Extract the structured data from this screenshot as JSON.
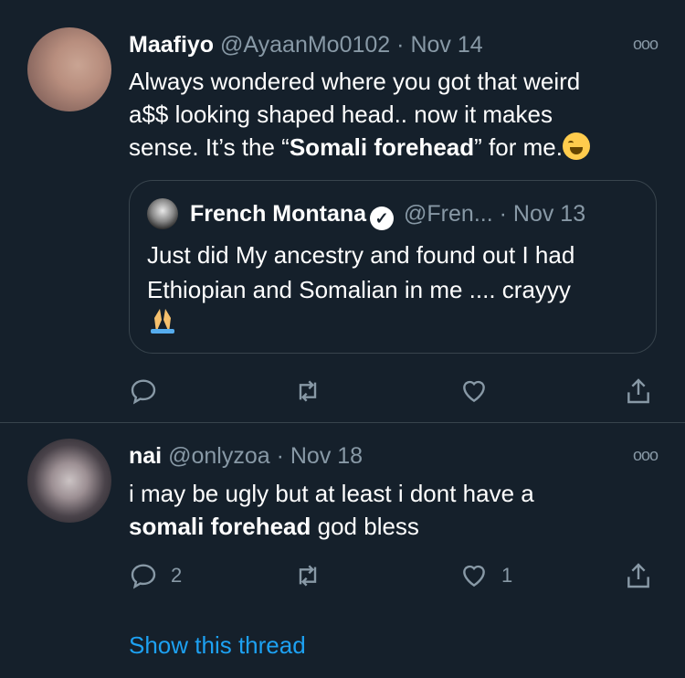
{
  "tweet1": {
    "name": "Maafiyo",
    "handle": "@AyaanMo0102",
    "sep": "·",
    "date": "Nov 14",
    "more": "ooo",
    "text_line1": "Always wondered where you got that weird",
    "text_line2": "a$$ looking shaped head.. now it makes",
    "text_line3_pre": "sense. It’s the “",
    "text_line3_bold": "Somali forehead",
    "text_line3_post": "” for me.",
    "emoji": "face-with-tears-of-joy-icon"
  },
  "quote": {
    "name": "French Montana",
    "verified": "✓",
    "handle": "@Fren...",
    "sep": "·",
    "date": "Nov 13",
    "text_line1": "Just did My ancestry and found out I had",
    "text_line2": "Ethiopian and Somalian in me .... crayyy",
    "emoji": "folded-hands-icon"
  },
  "tweet2": {
    "name": "nai",
    "handle": "@onlyzoa",
    "sep": "·",
    "date": "Nov 18",
    "more": "ooo",
    "text_line1": "i may be ugly but at least i dont have a",
    "text_line2_bold": "somali forehead",
    "text_line2_post": " god bless",
    "reply_count": "2",
    "like_count": "1"
  },
  "show_thread": "Show this thread",
  "colors": {
    "background": "#15202b",
    "muted": "#8899a6",
    "accent": "#1da1f2",
    "border": "#38444d"
  }
}
